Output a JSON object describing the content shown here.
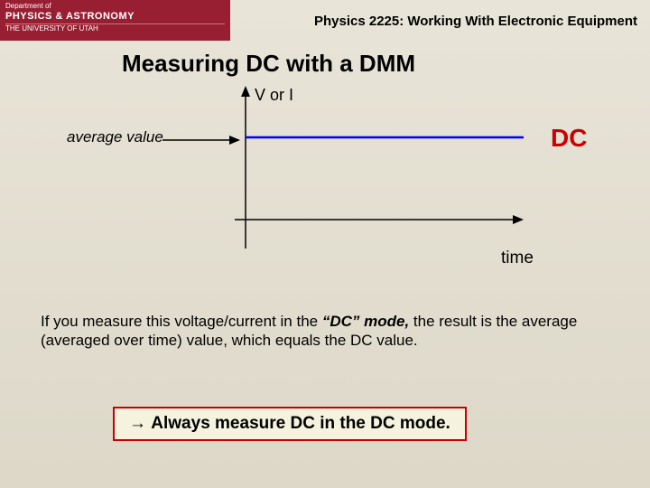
{
  "header": {
    "dept_line": "Department of",
    "astro_line": "PHYSICS & ASTRONOMY",
    "univ_line": "THE UNIVERSITY OF UTAH",
    "course_title": "Physics 2225: Working With Electronic Equipment"
  },
  "slide": {
    "title": "Measuring DC with a DMM",
    "y_axis_label": "V or I",
    "avg_label": "average value",
    "dc_label": "DC",
    "x_axis_label": "time",
    "body_pre": "If you measure this voltage/current in the ",
    "body_em": "“DC” mode,",
    "body_post": " the result is the average (averaged over time) value, which equals the DC value.",
    "callout": " Always measure DC in the DC mode."
  },
  "chart_data": {
    "type": "line",
    "title": "",
    "xlabel": "time",
    "ylabel": "V or I",
    "series": [
      {
        "name": "DC (average value)",
        "x": [
          0,
          1
        ],
        "values": [
          1,
          1
        ],
        "color": "#0000ff"
      }
    ],
    "xlim": [
      0,
      1
    ],
    "ylim": [
      0,
      2
    ],
    "annotations": [
      "average value",
      "DC"
    ]
  }
}
